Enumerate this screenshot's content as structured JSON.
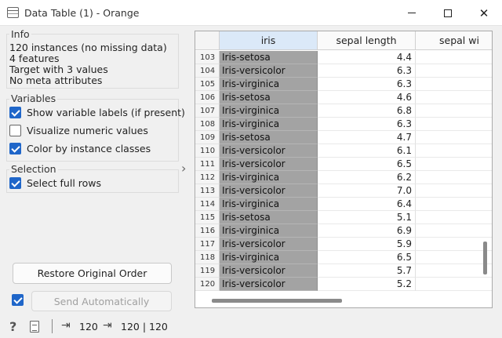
{
  "window": {
    "title": "Data Table (1) - Orange",
    "minimize_icon": "minimize-icon",
    "maximize_icon": "maximize-icon",
    "close_glyph": "✕"
  },
  "info": {
    "title": "Info",
    "lines": [
      "120 instances (no missing data)",
      "4 features",
      "Target with 3 values",
      "No meta attributes"
    ]
  },
  "variables": {
    "title": "Variables",
    "options": [
      {
        "label": "Show variable labels (if present)",
        "checked": true
      },
      {
        "label": "Visualize numeric values",
        "checked": false
      },
      {
        "label": "Color by instance classes",
        "checked": true
      }
    ]
  },
  "selection": {
    "title": "Selection",
    "options": [
      {
        "label": "Select full rows",
        "checked": true
      }
    ]
  },
  "buttons": {
    "restore": "Restore Original Order",
    "send": "Send Automatically",
    "send_auto_checked": true
  },
  "table": {
    "columns": [
      "iris",
      "sepal length",
      "sepal wi"
    ],
    "rows": [
      {
        "index": "103",
        "iris": "Iris-setosa",
        "sepal_length": "4.4"
      },
      {
        "index": "104",
        "iris": "Iris-versicolor",
        "sepal_length": "6.3"
      },
      {
        "index": "105",
        "iris": "Iris-virginica",
        "sepal_length": "6.3"
      },
      {
        "index": "106",
        "iris": "Iris-setosa",
        "sepal_length": "4.6"
      },
      {
        "index": "107",
        "iris": "Iris-virginica",
        "sepal_length": "6.8"
      },
      {
        "index": "108",
        "iris": "Iris-virginica",
        "sepal_length": "6.3"
      },
      {
        "index": "109",
        "iris": "Iris-setosa",
        "sepal_length": "4.7"
      },
      {
        "index": "110",
        "iris": "Iris-versicolor",
        "sepal_length": "6.1"
      },
      {
        "index": "111",
        "iris": "Iris-versicolor",
        "sepal_length": "6.5"
      },
      {
        "index": "112",
        "iris": "Iris-virginica",
        "sepal_length": "6.2"
      },
      {
        "index": "113",
        "iris": "Iris-versicolor",
        "sepal_length": "7.0"
      },
      {
        "index": "114",
        "iris": "Iris-virginica",
        "sepal_length": "6.4"
      },
      {
        "index": "115",
        "iris": "Iris-setosa",
        "sepal_length": "5.1"
      },
      {
        "index": "116",
        "iris": "Iris-virginica",
        "sepal_length": "6.9"
      },
      {
        "index": "117",
        "iris": "Iris-versicolor",
        "sepal_length": "5.9"
      },
      {
        "index": "118",
        "iris": "Iris-virginica",
        "sepal_length": "6.5"
      },
      {
        "index": "119",
        "iris": "Iris-versicolor",
        "sepal_length": "5.7"
      },
      {
        "index": "120",
        "iris": "Iris-versicolor",
        "sepal_length": "5.2"
      }
    ]
  },
  "status": {
    "input_count": "120",
    "output_count": "120 | 120"
  },
  "colors": {
    "accent": "#1f66c9",
    "class_cell": "#a3a3a3",
    "header_active": "#dbe9f8"
  }
}
